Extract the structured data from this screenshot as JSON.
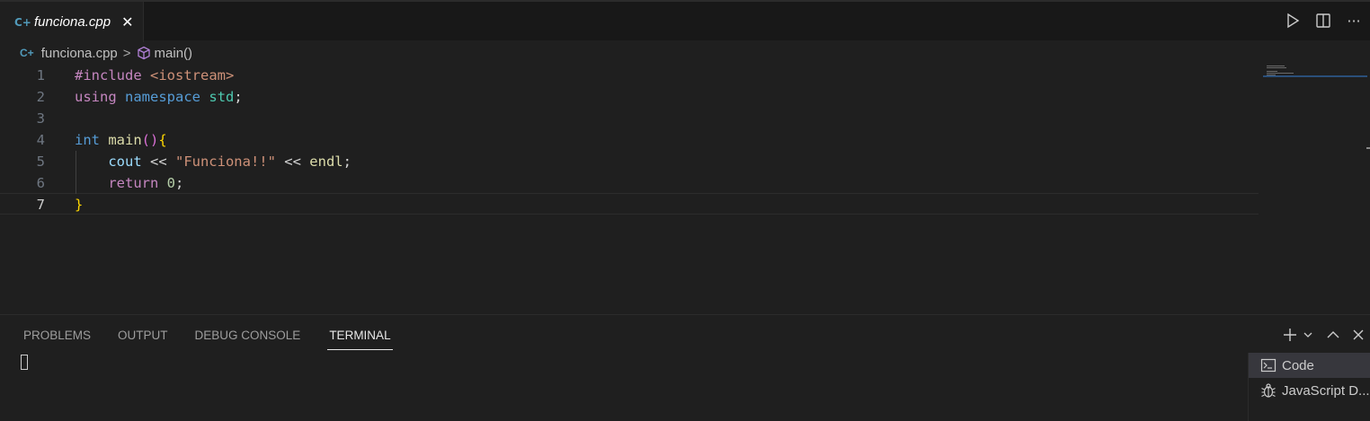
{
  "tab": {
    "file_icon": "C+",
    "label": "funciona.cpp",
    "close": "✕"
  },
  "editor_actions": {
    "run": "run-icon",
    "split": "split-editor-icon",
    "more": "···"
  },
  "breadcrumb": {
    "file_icon": "C+",
    "file": "funciona.cpp",
    "separator": ">",
    "symbol": "main()"
  },
  "code": {
    "line_numbers": [
      "1",
      "2",
      "3",
      "4",
      "5",
      "6",
      "7"
    ],
    "l1": {
      "pre": "#include",
      "sp": " ",
      "inc": "<iostream>"
    },
    "l2": {
      "using": "using",
      "sp1": " ",
      "namespace": "namespace",
      "sp2": " ",
      "std": "std",
      "semi": ";"
    },
    "l4": {
      "int": "int",
      "sp": " ",
      "main": "main",
      "paren": "()",
      "brace": "{"
    },
    "l5": {
      "indent": "    ",
      "cout": "cout",
      "op1": " << ",
      "str": "\"Funciona!!\"",
      "op2": " << ",
      "endl": "endl",
      "semi": ";"
    },
    "l6": {
      "indent": "    ",
      "ret": "return",
      "sp": " ",
      "num": "0",
      "semi": ";"
    },
    "l7": {
      "brace": "}"
    }
  },
  "panel": {
    "tabs": [
      "PROBLEMS",
      "OUTPUT",
      "DEBUG CONSOLE",
      "TERMINAL"
    ],
    "active_tab": "TERMINAL",
    "terminals": [
      {
        "label": "Code",
        "icon": "terminal-icon",
        "selected": true
      },
      {
        "label": "JavaScript D...",
        "icon": "debug-icon",
        "selected": false
      }
    ]
  }
}
